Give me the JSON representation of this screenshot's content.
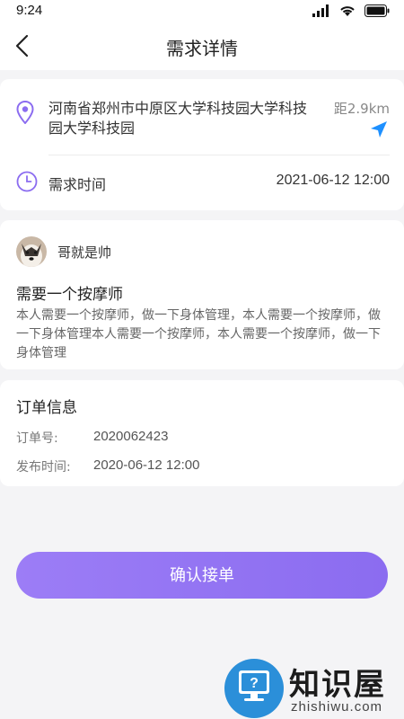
{
  "status_bar": {
    "time": "9:24"
  },
  "header": {
    "title": "需求详情"
  },
  "location": {
    "address": "河南省郑州市中原区大学科技园大学科技园大学科技园",
    "distance": "距2.9km"
  },
  "schedule": {
    "label": "需求时间",
    "value": "2021-06-12 12:00"
  },
  "request": {
    "user_name": "哥就是帅",
    "title": "需要一个按摩师",
    "description": "本人需要一个按摩师，做一下身体管理，本人需要一个按摩师，做一下身体管理本人需要一个按摩师，本人需要一个按摩师，做一下身体管理"
  },
  "order": {
    "section_title": "订单信息",
    "number_label": "订单号:",
    "number_value": "2020062423",
    "publish_label": "发布时间:",
    "publish_value": "2020-06-12 12:00"
  },
  "action": {
    "confirm_label": "确认接单"
  },
  "watermark": {
    "text": "知识屋",
    "url": "zhishiwu.com"
  },
  "colors": {
    "accent": "#8b6cf0",
    "nav_arrow": "#1e90ff",
    "logo_blue": "#2b8fd9"
  }
}
